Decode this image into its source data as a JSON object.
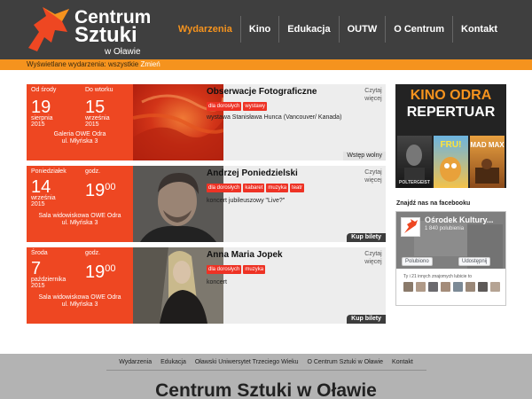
{
  "logo": {
    "line1": "Centrum",
    "line2": "Sztuki",
    "line3": "w Oławie"
  },
  "nav": [
    "Wydarzenia",
    "Kino",
    "Edukacja",
    "OUTW",
    "O Centrum",
    "Kontakt"
  ],
  "filter": {
    "label": "Wyświetlane wydarzenia: wszystkie",
    "change": "Zmień"
  },
  "events": [
    {
      "from_label": "Od środy",
      "from_day": "19",
      "from_month": "sierpnia",
      "from_year": "2015",
      "to_label": "Do wtorku",
      "to_day": "15",
      "to_month": "września",
      "to_year": "2015",
      "place1": "Galeria OWE Odra",
      "place2": "ul. Młyńska 3",
      "title": "Obserwacje Fotograficzne",
      "tags": [
        "dla dorosłych",
        "wystawy"
      ],
      "desc": "wystawa Stanisława Hunca (Vancouver/ Kanada)",
      "more1": "Czytaj",
      "more2": "więcej",
      "action": "Wstęp wolny"
    },
    {
      "day_label": "Poniedziałek",
      "day": "14",
      "month": "września",
      "year": "2015",
      "time_label": "godz.",
      "hour": "19",
      "minute": "00",
      "place1": "Sala widowiskowa OWE Odra",
      "place2": "ul. Młyńska 3",
      "title": "Andrzej Poniedzielski",
      "tags": [
        "dla dorosłych",
        "kabaret",
        "muzyka",
        "teatr"
      ],
      "desc": "koncert jubileuszowy \"Live?\"",
      "more1": "Czytaj",
      "more2": "więcej",
      "action": "Kup bilety"
    },
    {
      "day_label": "Środa",
      "day": "7",
      "month": "października",
      "year": "2015",
      "time_label": "godz.",
      "hour": "19",
      "minute": "00",
      "place1": "Sala widowiskowa OWE Odra",
      "place2": "ul. Młyńska 3",
      "title": "Anna Maria Jopek",
      "tags": [
        "dla dorosłych",
        "muzyka"
      ],
      "desc": "koncert",
      "more1": "Czytaj",
      "more2": "więcej",
      "action": "Kup bilety"
    }
  ],
  "kino": {
    "line1": "KINO ODRA",
    "line2": "REPERTUAR",
    "posters": [
      "POLTERGEIST",
      "FRU!",
      "MAD MAX"
    ]
  },
  "facebook": {
    "heading": "Znajdź nas na facebooku",
    "page_name": "Ośrodek Kultury...",
    "likes": "1 840 polubienia",
    "like_btn": "Polubiono",
    "share_btn": "Udostępnij",
    "friends": "Ty i 21 innych znajomych lubicie to"
  },
  "footer": {
    "links": [
      "Wydarzenia",
      "Edukacja",
      "Oławski Uniwersytet Trzeciego Wieku",
      "O Centrum Sztuki w Oławie",
      "Kontakt"
    ],
    "title": "Centrum Sztuki w Oławie"
  },
  "colors": {
    "accent": "#f5931e",
    "event_red": "#ee4722",
    "header": "#3f3f3f",
    "tag": "#ee3224"
  }
}
